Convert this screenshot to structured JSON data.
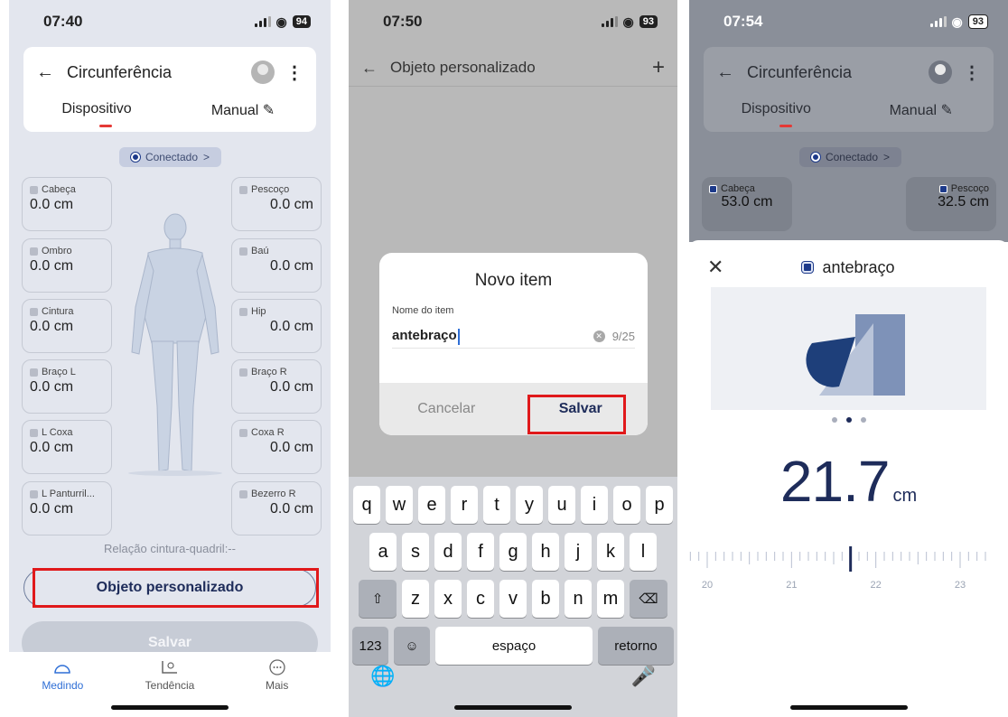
{
  "screen1": {
    "status": {
      "time": "07:40",
      "battery": "94"
    },
    "header": {
      "title": "Circunferência"
    },
    "tabs": [
      {
        "label": "Dispositivo"
      },
      {
        "label": "Manual"
      }
    ],
    "connection": {
      "label": "Conectado",
      "chevron": ">"
    },
    "measurements_left": [
      {
        "label": "Cabeça",
        "value": "0.0 cm"
      },
      {
        "label": "Ombro",
        "value": "0.0 cm"
      },
      {
        "label": "Cintura",
        "value": "0.0 cm"
      },
      {
        "label": "Braço L",
        "value": "0.0 cm"
      },
      {
        "label": "L Coxa",
        "value": "0.0 cm"
      },
      {
        "label": "L Panturril...",
        "value": "0.0 cm"
      }
    ],
    "measurements_right": [
      {
        "label": "Pescoço",
        "value": "0.0 cm"
      },
      {
        "label": "Baú",
        "value": "0.0 cm"
      },
      {
        "label": "Hip",
        "value": "0.0 cm"
      },
      {
        "label": "Braço R",
        "value": "0.0 cm"
      },
      {
        "label": "Coxa R",
        "value": "0.0 cm"
      },
      {
        "label": "Bezerro R",
        "value": "0.0 cm"
      }
    ],
    "ratio_text": "Relação cintura-quadril:--",
    "custom_button": "Objeto personalizado",
    "save_button": "Salvar",
    "bottom_nav": [
      {
        "label": "Medindo",
        "icon": "scale-icon",
        "active": true
      },
      {
        "label": "Tendência",
        "icon": "trend-icon",
        "active": false
      },
      {
        "label": "Mais",
        "icon": "more-icon",
        "active": false
      }
    ]
  },
  "screen2": {
    "status": {
      "time": "07:50",
      "battery": "93"
    },
    "nav": {
      "title": "Objeto personalizado"
    },
    "dialog": {
      "title": "Novo item",
      "field_label": "Nome do item",
      "field_value": "antebraço",
      "counter": "9/25",
      "cancel": "Cancelar",
      "save": "Salvar"
    },
    "keyboard": {
      "row1": [
        "q",
        "w",
        "e",
        "r",
        "t",
        "y",
        "u",
        "i",
        "o",
        "p"
      ],
      "row2": [
        "a",
        "s",
        "d",
        "f",
        "g",
        "h",
        "j",
        "k",
        "l"
      ],
      "row3": [
        "z",
        "x",
        "c",
        "v",
        "b",
        "n",
        "m"
      ],
      "numbers": "123",
      "space": "espaço",
      "return": "retorno"
    }
  },
  "screen3": {
    "status": {
      "time": "07:54",
      "battery": "93"
    },
    "header": {
      "title": "Circunferência"
    },
    "tabs": [
      {
        "label": "Dispositivo"
      },
      {
        "label": "Manual"
      }
    ],
    "connection": {
      "label": "Conectado",
      "chevron": ">"
    },
    "measurements": [
      {
        "label": "Cabeça",
        "value": "53.0 cm"
      },
      {
        "label": "Pescoço",
        "value": "32.5 cm"
      }
    ],
    "sheet": {
      "title": "antebraço",
      "value": "21.7",
      "unit": "cm",
      "page_index": 1,
      "page_count": 3,
      "ruler_labels": [
        "20",
        "21",
        "22",
        "23"
      ],
      "ruler_value": 21.7
    }
  },
  "colors": {
    "accent_navy": "#1e2c5a",
    "highlight_red": "#e0191b",
    "active_nav_blue": "#2f6fd6"
  }
}
